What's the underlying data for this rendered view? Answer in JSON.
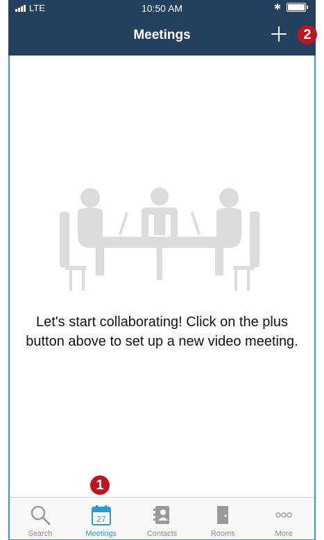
{
  "status": {
    "carrier": "LTE",
    "time": "10:50 AM"
  },
  "header": {
    "title": "Meetings"
  },
  "empty_state": {
    "message": "Let's start collaborating!  Click on the plus button above to set up a new video meeting."
  },
  "badges": {
    "one": "1",
    "two": "2"
  },
  "tabs": [
    {
      "label": "Search",
      "icon": "search-icon"
    },
    {
      "label": "Meetings",
      "icon": "calendar-icon",
      "day": "27",
      "active": true
    },
    {
      "label": "Contacts",
      "icon": "contacts-icon"
    },
    {
      "label": "Rooms",
      "icon": "door-icon"
    },
    {
      "label": "More",
      "icon": "more-icon"
    }
  ],
  "colors": {
    "header": "#23405f",
    "accent": "#2b9bd6",
    "badge": "#c0141e"
  }
}
